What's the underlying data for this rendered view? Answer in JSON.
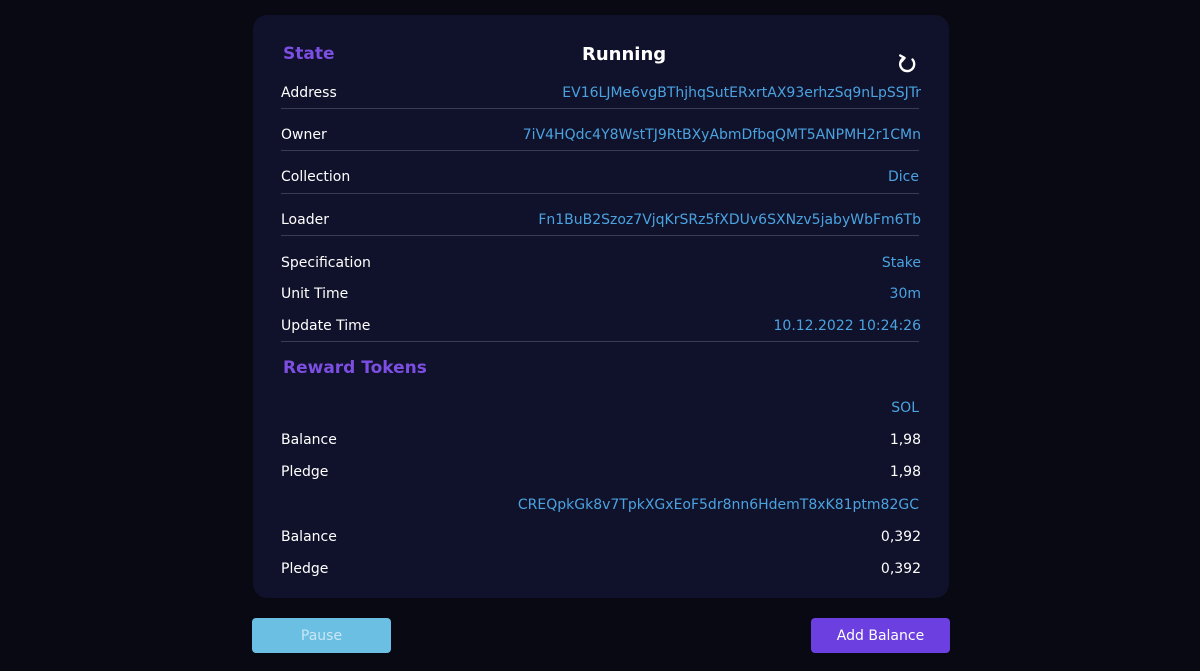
{
  "state": {
    "title": "State",
    "value": "Running"
  },
  "info": {
    "address_label": "Address",
    "address_value": "EV16LJMe6vgBThjhqSutERxrtAX93erhzSq9nLpSSJTr",
    "owner_label": "Owner",
    "owner_value": "7iV4HQdc4Y8WstTJ9RtBXyAbmDfbqQMT5ANPMH2r1CMn",
    "collection_label": "Collection",
    "collection_value": "Dice",
    "loader_label": "Loader",
    "loader_value": "Fn1BuB2Szoz7VjqKrSRz5fXDUv6SXNzv5jabyWbFm6Tb",
    "specification_label": "Specification",
    "specification_value": "Stake",
    "unit_time_label": "Unit Time",
    "unit_time_value": "30m",
    "update_time_label": "Update Time",
    "update_time_value": "10.12.2022 10:24:26"
  },
  "rewards": {
    "title": "Reward Tokens",
    "tokens": [
      {
        "name": "SOL",
        "balance_label": "Balance",
        "balance": "1,98",
        "pledge_label": "Pledge",
        "pledge": "1,98"
      },
      {
        "name": "CREQpkGk8v7TpkXGxEoF5dr8nn6HdemT8xK81ptm82GC",
        "balance_label": "Balance",
        "balance": "0,392",
        "pledge_label": "Pledge",
        "pledge": "0,392"
      }
    ]
  },
  "actions": {
    "pause_label": "Pause",
    "add_balance_label": "Add Balance"
  },
  "colors": {
    "accent_purple": "#7c4ee2",
    "link_blue": "#4aa3e0",
    "pause_button": "#6bbfe3",
    "add_button": "#6b3fe0"
  },
  "icons": {
    "refresh": "refresh-icon"
  }
}
